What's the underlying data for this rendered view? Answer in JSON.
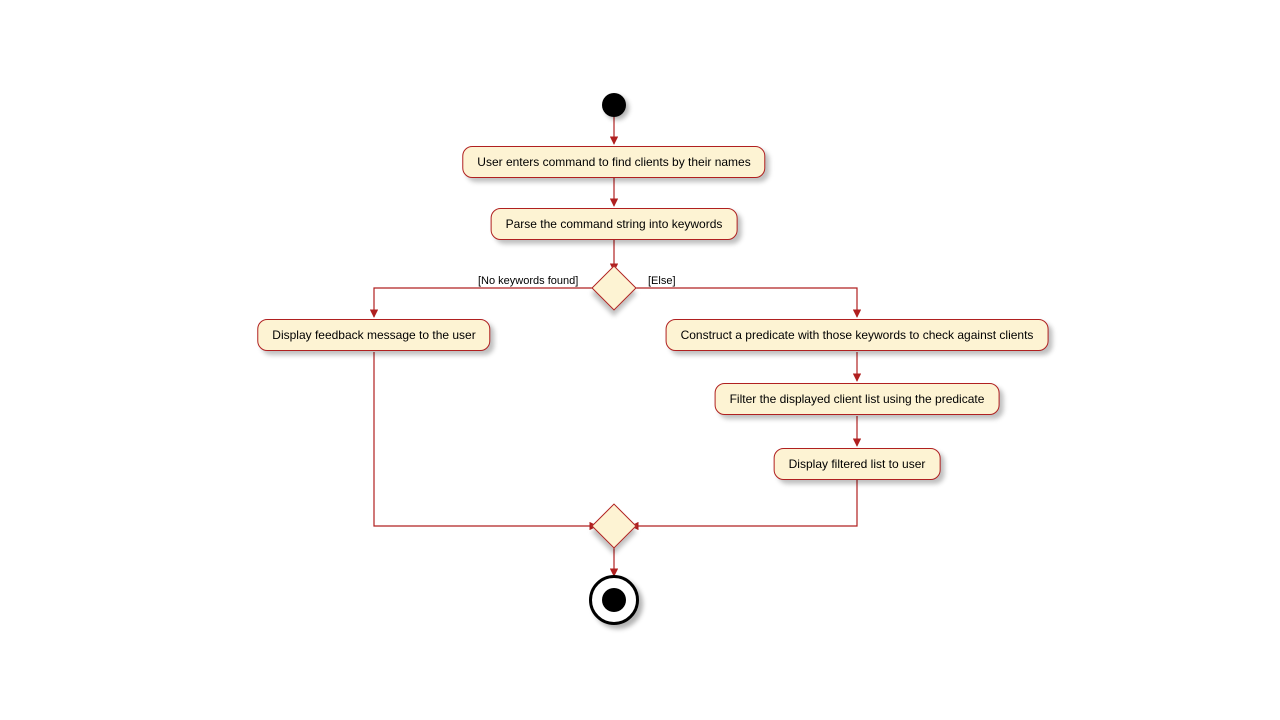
{
  "diagram": {
    "type": "uml-activity",
    "nodes": {
      "step1": "User enters command to find clients by their names",
      "step2": "Parse the command string into keywords",
      "left1": "Display feedback message to the user",
      "right1": "Construct a predicate with those keywords to check against clients",
      "right2": "Filter the displayed client list using the predicate",
      "right3": "Display filtered list to user"
    },
    "guards": {
      "noKeywords": "[No keywords found]",
      "else": "[Else]"
    }
  }
}
